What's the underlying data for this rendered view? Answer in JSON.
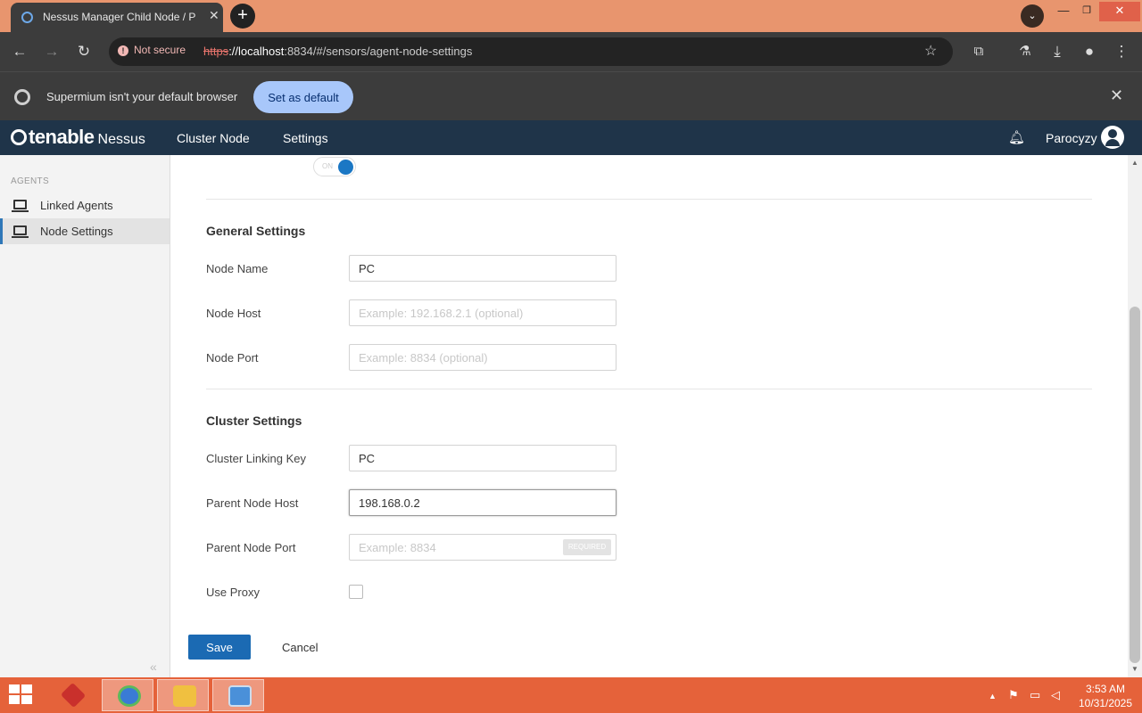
{
  "browser": {
    "tab_title": "Nessus Manager Child Node / P",
    "url_scheme": "https",
    "url_host": "://localhost",
    "url_rest": ":8834/#/sensors/agent-node-settings",
    "not_secure": "Not secure",
    "infobar_text": "Supermium isn't your default browser",
    "set_default_label": "Set as default"
  },
  "app": {
    "brand": "tenable",
    "product": "Nessus",
    "nav": [
      "Cluster Node",
      "Settings"
    ],
    "username": "Parocyzy"
  },
  "sidebar": {
    "section": "AGENTS",
    "items": [
      {
        "label": "Linked Agents",
        "active": false
      },
      {
        "label": "Node Settings",
        "active": true
      }
    ],
    "collapse_glyph": "«"
  },
  "main": {
    "toggle": {
      "text": "ON",
      "state": true
    },
    "general_title": "General Settings",
    "node_name": {
      "label": "Node Name",
      "value": "PC"
    },
    "node_host": {
      "label": "Node Host",
      "value": "",
      "placeholder": "Example: 192.168.2.1 (optional)"
    },
    "node_port": {
      "label": "Node Port",
      "value": "",
      "placeholder": "Example: 8834 (optional)"
    },
    "cluster_title": "Cluster Settings",
    "linking_key": {
      "label": "Cluster Linking Key",
      "value": "PC"
    },
    "parent_host": {
      "label": "Parent Node Host",
      "value": "198.168.0.2"
    },
    "parent_port": {
      "label": "Parent Node Port",
      "value": "",
      "placeholder": "Example: 8834",
      "badge": "REQUIRED"
    },
    "use_proxy": {
      "label": "Use Proxy",
      "checked": false
    },
    "save_label": "Save",
    "cancel_label": "Cancel"
  },
  "taskbar": {
    "time": "3:53 AM",
    "date": "10/31/2025"
  },
  "colors": {
    "accent": "#1b6ab3",
    "header": "#1f3449",
    "taskbar": "#e5623a",
    "tabstrip": "#e8956e"
  }
}
